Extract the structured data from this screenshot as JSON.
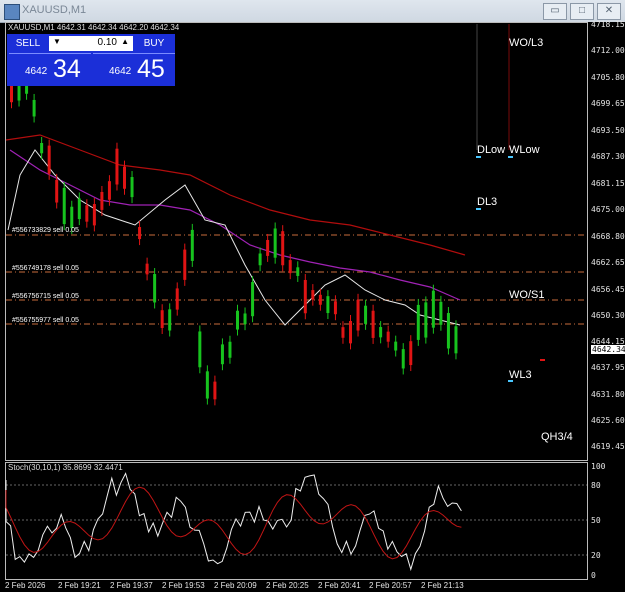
{
  "window": {
    "title": "XAUUSD,M1",
    "buttons": {
      "minimize": "▭",
      "maximize": "□",
      "close": "✕"
    }
  },
  "chart": {
    "header": "XAUUSD,M1  4642.31 4642.34 4642.20 4642.34",
    "bid_price": "4642.34",
    "price_axis": [
      "4718.15",
      "4712.00",
      "4705.80",
      "4699.65",
      "4693.50",
      "4687.30",
      "4681.15",
      "4675.00",
      "4668.80",
      "4662.65",
      "4656.45",
      "4650.30",
      "4644.15",
      "4637.95",
      "4631.80",
      "4625.60",
      "4619.45"
    ],
    "time_axis": [
      "2 Feb 2026",
      "2 Feb 19:21",
      "2 Feb 19:37",
      "2 Feb 19:53",
      "2 Feb 20:09",
      "2 Feb 20:25",
      "2 Feb 20:41",
      "2 Feb 20:57",
      "2 Feb 21:13"
    ],
    "orders": [
      {
        "label": "#556733829 sell 0.05"
      },
      {
        "label": "#556749178 sell 0.05"
      },
      {
        "label": "#556756715 sell 0.05"
      },
      {
        "label": "#556755977 sell 0.05"
      }
    ],
    "levels": [
      "WO/L3",
      "DLow",
      "WLow",
      "DL3",
      "WO/S1",
      "WL3",
      "QH3/4"
    ],
    "colors": {
      "up": "#17c31e",
      "down": "#e01414",
      "ma1": "#b10d0d",
      "ma2": "#a022b5",
      "ma3": "#e8e8e8",
      "order": "#c86b3c",
      "marker": "#4ac7ff"
    }
  },
  "trade_panel": {
    "sell_label": "SELL",
    "buy_label": "BUY",
    "lot": "0.10",
    "down_arrow": "▼",
    "up_arrow": "▲",
    "sell_small": "4642",
    "sell_big": "34",
    "buy_small": "4642",
    "buy_big": "45"
  },
  "stochastic": {
    "title": "Stoch(30,10,1) 35.8699 32.4471",
    "levels": [
      "100",
      "80",
      "50",
      "20",
      "0"
    ]
  }
}
